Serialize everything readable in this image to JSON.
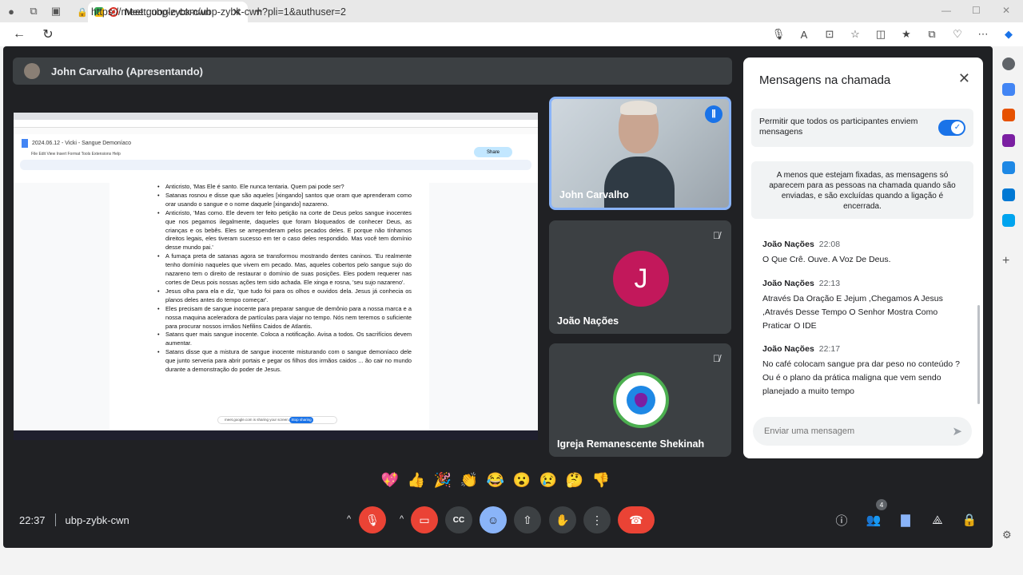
{
  "browser": {
    "tab_title": "Meet: ubp-zybk-cwn",
    "url": "https://meet.google.com/ubp-zybk-cwn?pli=1&authuser=2",
    "icons": [
      "profile-icon",
      "workspaces-icon",
      "tab-actions-icon",
      "back-icon",
      "refresh-icon",
      "mic-icon",
      "read-aloud-icon",
      "app-icon",
      "favorite-icon",
      "split-screen-icon",
      "favorites-icon",
      "collections-icon",
      "browser-essentials-icon",
      "more-icon",
      "copilot-icon"
    ]
  },
  "meet": {
    "presenter_bar": "John Carvalho (Apresentando)",
    "time": "22:37",
    "meeting_code": "ubp-zybk-cwn",
    "participants_count": "4",
    "tiles": [
      {
        "name": "John Carvalho",
        "state": "speaking"
      },
      {
        "name": "João Nações",
        "initial": "J",
        "avatar_color": "#c2185b"
      },
      {
        "name": "Igreja Remanescente Shekinah"
      }
    ]
  },
  "shared_doc": {
    "title": "2024.06.12 - Vicki - Sangue Demoníaco",
    "menu": "File  Edit  View  Insert  Format  Tools  Extensions  Help",
    "share_label": "Share",
    "share_bar": "meet.google.com is sharing your screen.",
    "stop_label": "Stop sharing",
    "paragraphs": [
      "Anticristo, 'Mas Ele é santo. Ele nunca tentaria. Quem pai pode ser?",
      "Satanas rosnou e disse que são aqueles [xingando] santos que oram que aprenderam como orar usando o sangue e o nome daquele [xingando] nazareno.",
      "Anticristo, 'Mas como. Ele devem ter feito petição na corte de Deus pelos sangue inocentes que nos pegamos ilegalmente, daqueles que foram bloqueados de conhecer Deus, as crianças e os bebês. Eles se arrependeram pelos pecados deles. E porque não tínhamos direitos legais, eles tiveram sucesso em ter o caso deles respondido. Mas você tem domínio desse mundo pai.'",
      "A fumaça preta de satanas agora se transformou mostrando dentes caninos. 'Eu realmente tenho domínio naqueles que vivem em pecado. Mas, aqueles cobertos pelo sangue sujo do nazareno tem o direito de restaurar o domínio de suas posições. Eles podem requerer nas cortes de Deus pois nossas ações tem sido achada. Ele xinga e rosna, 'seu sujo nazareno'.",
      "Jesus olha para ela e diz, 'que tudo foi para os olhos e ouvidos dela. Jesus já conhecia os planos deles antes do tempo começar'.",
      "Eles precisam de sangue inocente para preparar sangue de demônio para a nossa marca e a nossa maquina aceleradora de partículas para viajar no tempo. Nós nem teremos o suficiente para procurar nossos irmãos Nefilins Caidos de Atlantis.",
      "Satans quer mais sangue inocente. Coloca a notificação. Avisa a todos. Os sacrifícios devem aumentar.",
      "Satans disse que a mistura de sangue inocente misturando com o sangue demoníaco dele que junto serveria para abrir portais e pegar os filhos dos irmãos caidos ... ão cair no mundo durante a demonstração do poder de Jesus."
    ]
  },
  "chat": {
    "title": "Mensagens na chamada",
    "permission_text": "Permitir que todos os participantes enviem mensagens",
    "notice": "A menos que estejam fixadas, as mensagens só aparecem para as pessoas na chamada quando são enviadas, e são excluídas quando a ligação é encerrada.",
    "messages": [
      {
        "sender": "João Nações",
        "time": "22:08",
        "text": "O Que Crê. Ouve. A Voz De Deus."
      },
      {
        "sender": "João Nações",
        "time": "22:13",
        "text": "Através Da Oração E Jejum ,Chegamos A Jesus ,Através Desse Tempo O Senhor Mostra Como Praticar O IDE"
      },
      {
        "sender": "João Nações",
        "time": "22:17",
        "text": "No café colocam sangue pra dar peso no conteúdo ? Ou é o plano da prática maligna que vem sendo planejado a muito tempo"
      }
    ],
    "placeholder": "Enviar uma mensagem"
  },
  "reactions": [
    "💖",
    "👍",
    "🎉",
    "👏",
    "😂",
    "😮",
    "😢",
    "🤔",
    "👎"
  ],
  "colors": {
    "accent": "#1a73e8",
    "end_call": "#ea4335",
    "stage_bg": "#202124",
    "tile_bg": "#3c4043"
  }
}
